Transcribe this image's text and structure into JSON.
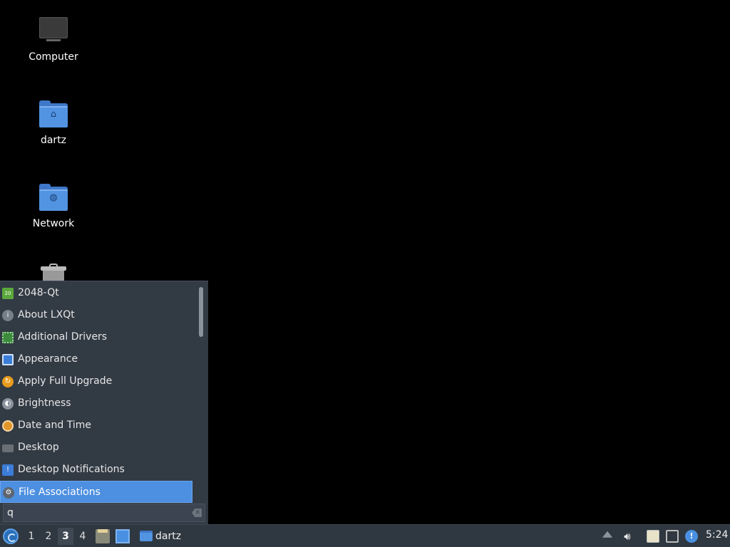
{
  "desktop_icons": [
    {
      "label": "Computer",
      "icon": "computer-icon"
    },
    {
      "label": "dartz",
      "icon": "home-folder-icon"
    },
    {
      "label": "Network",
      "icon": "network-folder-icon"
    },
    {
      "label": "",
      "icon": "trash-icon"
    }
  ],
  "menu": {
    "items": [
      {
        "label": "2048-Qt",
        "icon": "game-2048-icon",
        "color": "#5aa83b"
      },
      {
        "label": "About LXQt",
        "icon": "info-icon",
        "color": "#777f88"
      },
      {
        "label": "Additional Drivers",
        "icon": "chip-icon",
        "color": "#3d8c3d"
      },
      {
        "label": "Appearance",
        "icon": "appearance-icon",
        "color": "#3b7dd8"
      },
      {
        "label": "Apply Full Upgrade",
        "icon": "upgrade-icon",
        "color": "#e89b1c"
      },
      {
        "label": "Brightness",
        "icon": "brightness-icon",
        "color": "#8a929c"
      },
      {
        "label": "Date and Time",
        "icon": "clock-icon",
        "color": "#e0962a"
      },
      {
        "label": "Desktop",
        "icon": "desktop-icon",
        "color": "#6a6f76"
      },
      {
        "label": "Desktop Notifications",
        "icon": "notification-icon",
        "color": "#3b7dd8"
      },
      {
        "label": "File Associations",
        "icon": "file-associations-icon",
        "color": "#5d6670"
      }
    ],
    "selected_index": 9,
    "search": {
      "value": "q",
      "placeholder": ""
    }
  },
  "taskbar": {
    "desktops": [
      "1",
      "2",
      "3",
      "4"
    ],
    "active_desktop": "3",
    "task_label": "dartz",
    "clock": "5:24"
  }
}
